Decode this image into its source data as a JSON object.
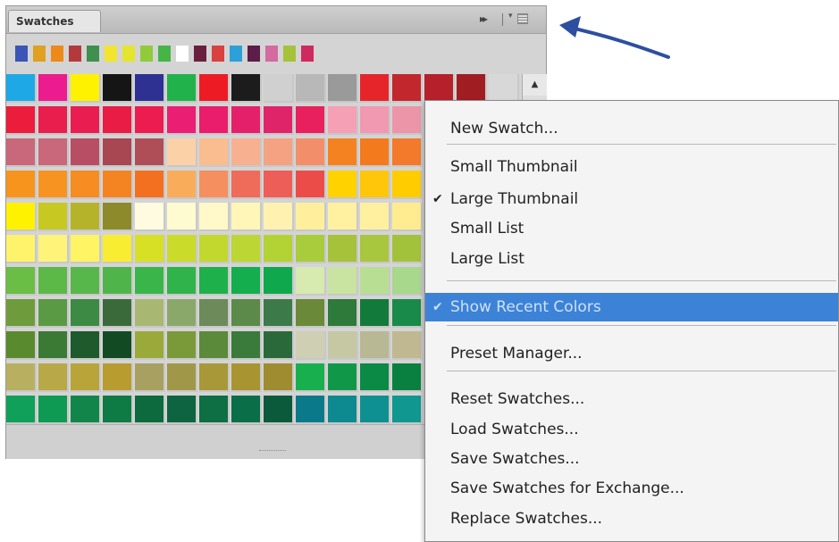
{
  "panel": {
    "tab_label": "Swatches",
    "collapse_glyph": "▸▸",
    "menu_glyph": "▾≡"
  },
  "recent_colors": [
    "#3a55b5",
    "#e0a020",
    "#ee8a1a",
    "#b33a3a",
    "#3f8f4f",
    "#f1e52e",
    "#e4e62e",
    "#8fcb3a",
    "#45b547",
    "#ffffff",
    "#6b1f3f",
    "#d9423e",
    "#2ea0d8",
    "#5c1d49",
    "#d36aa0",
    "#a6c23a",
    "#cf2a5f"
  ],
  "swatch_rows": [
    [
      "#1ea9e6",
      "#ec1c8e",
      "#fff200",
      "#151515",
      "#2e3192",
      "#21b24b",
      "#ed1c24",
      "#1c1c1c",
      "#d0d0d0",
      "#b8b8b8",
      "#9a9a9a",
      "#e6252a",
      "#c1272d",
      "#b5202a",
      "#a01d22",
      "#d8d8d8"
    ],
    [
      "#ec1c3c",
      "#e91e4c",
      "#ea1d50",
      "#e81c44",
      "#ec1c50",
      "#ea1e72",
      "#e91d6c",
      "#e5206a",
      "#e0246a",
      "#e8205e",
      "#f5a0b4",
      "#f099b0",
      "#ec95a8",
      "#e8a0b0",
      "#e8a4b4",
      "#e0a0b0"
    ],
    [
      "#c8687a",
      "#c8687a",
      "#b84e64",
      "#a84652",
      "#b04e58",
      "#fbd1a8",
      "#f9bd90",
      "#f7b090",
      "#f5a282",
      "#f28f6a",
      "#f58220",
      "#f47a1e",
      "#f27a2a",
      "#ee6a30",
      "#ec6030",
      "#e85a30"
    ],
    [
      "#f7941d",
      "#f79421",
      "#f58d22",
      "#f48422",
      "#f37021",
      "#f9ad5a",
      "#f58f5f",
      "#ef6b5a",
      "#ee5e58",
      "#ec4c48",
      "#ffd200",
      "#ffc60a",
      "#ffcc00",
      "#fdd000",
      "#ffd000",
      "#fcc800"
    ],
    [
      "#fff200",
      "#c8c822",
      "#b5b32a",
      "#8c8a2a",
      "#fffbe0",
      "#fffbd0",
      "#fff8c8",
      "#fff6b8",
      "#fff2b0",
      "#ffef9c",
      "#fff1a0",
      "#fff0a0",
      "#ffec90",
      "#ffe888",
      "#ffe480",
      "#ffe078"
    ],
    [
      "#fff36b",
      "#fff37a",
      "#fff464",
      "#f9ed32",
      "#d7e025",
      "#cadb2a",
      "#c2d82f",
      "#bcd633",
      "#b3d234",
      "#a8cc3c",
      "#a5c23a",
      "#a8c63e",
      "#a2c23c",
      "#9cc040",
      "#98bc40",
      "#92b840"
    ],
    [
      "#6abd45",
      "#5cb847",
      "#58b74a",
      "#4fb54a",
      "#39b54a",
      "#2fb34a",
      "#1eb04b",
      "#14ae4e",
      "#10a84c",
      "#d7eab0",
      "#c8e4a0",
      "#b8de94",
      "#a8d88c",
      "#9cd28a",
      "#94cc84",
      "#8ec680"
    ],
    [
      "#6e9c3c",
      "#5a9a44",
      "#3c8a44",
      "#3b6a3a",
      "#a8b873",
      "#8aa86a",
      "#6c8a5a",
      "#5c8a4a",
      "#3c7a4a",
      "#6a8a3a",
      "#2e7a3a",
      "#127a3a",
      "#1a8a4a",
      "#108a46",
      "#0f8444",
      "#0c7c40"
    ],
    [
      "#5a8a2e",
      "#3a7a34",
      "#1e5a2c",
      "#124a24",
      "#9aaa3a",
      "#7a9a3a",
      "#5a8a3a",
      "#3a7a3a",
      "#2a6a3a",
      "#cfcfb4",
      "#c6c8a4",
      "#b8b894",
      "#c0b890",
      "#b8b080",
      "#b0a878",
      "#a8a070"
    ],
    [
      "#b8b060",
      "#b8a848",
      "#b8a438",
      "#b89c30",
      "#a8a060",
      "#a09848",
      "#a89838",
      "#a89430",
      "#a08c30",
      "#18b04e",
      "#109848",
      "#0a8a44",
      "#0a8040",
      "#0c7a3e",
      "#0a743c",
      "#08703a"
    ],
    [
      "#10a05a",
      "#0e9a52",
      "#12864a",
      "#0e7a44",
      "#0c6a3e",
      "#0e6440",
      "#0e6e44",
      "#0a6e48",
      "#0c5a3c",
      "#0a7a8a",
      "#0c8a90",
      "#0e9090",
      "#109890",
      "#10a090",
      "#12a88c",
      "#14a888"
    ]
  ],
  "menu": {
    "items": [
      {
        "label": "New Swatch...",
        "checked": false,
        "highlighted": false
      },
      {
        "label": "Small Thumbnail",
        "checked": false,
        "highlighted": false
      },
      {
        "label": "Large Thumbnail",
        "checked": true,
        "highlighted": false
      },
      {
        "label": "Small List",
        "checked": false,
        "highlighted": false
      },
      {
        "label": "Large List",
        "checked": false,
        "highlighted": false
      },
      {
        "label": "Show Recent Colors",
        "checked": true,
        "highlighted": true
      },
      {
        "label": "Preset Manager...",
        "checked": false,
        "highlighted": false
      },
      {
        "label": "Reset Swatches...",
        "checked": false,
        "highlighted": false
      },
      {
        "label": "Load Swatches...",
        "checked": false,
        "highlighted": false
      },
      {
        "label": "Save Swatches...",
        "checked": false,
        "highlighted": false
      },
      {
        "label": "Save Swatches for Exchange...",
        "checked": false,
        "highlighted": false
      },
      {
        "label": "Replace Swatches...",
        "checked": false,
        "highlighted": false
      }
    ],
    "check_glyph": "✔"
  },
  "colors": {
    "highlight": "#3c83d8",
    "arrow": "#2d4fa0"
  }
}
